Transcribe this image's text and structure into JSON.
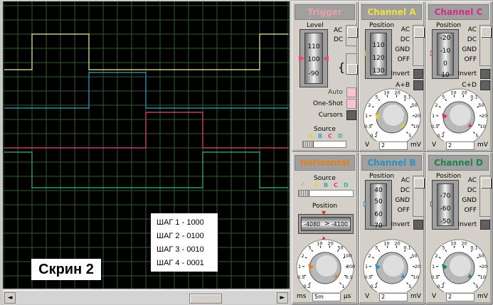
{
  "screen": {
    "steps": [
      "ШАГ 1 - 1000",
      "ШАГ 2 - 0100",
      "ШАГ 3 - 0010",
      "ШАГ 4 - 0001"
    ],
    "caption": "Скрин 2",
    "scroll_left": "◄",
    "scroll_right": "►",
    "colors": {
      "a": "#f0f0a0",
      "b": "#40a0c0",
      "c": "#e05070",
      "d": "#40b080"
    }
  },
  "trigger": {
    "title": "Trigger",
    "level": "Level",
    "ac": "AC",
    "dc": "DC",
    "drum": [
      "110",
      "100",
      "-90"
    ],
    "auto": "Auto",
    "one_shot": "One-Shot",
    "cursors": "Cursors",
    "source": "Source",
    "sources": [
      "A",
      "B",
      "C",
      "D"
    ]
  },
  "channel_a": {
    "title": "Channel A",
    "position": "Position",
    "ac": "AC",
    "dc": "DC",
    "gnd": "GND",
    "off": "OFF",
    "drum": [
      "110",
      "120",
      "130"
    ],
    "invert": "Invert",
    "sum": "A+B",
    "dial_labels": [
      "0.2",
      "0.5",
      "1",
      "2",
      "5",
      "10",
      "20",
      "0.1",
      "50",
      "20",
      "10",
      "5"
    ],
    "unit_left": "V",
    "value": "2",
    "unit_right": "mV"
  },
  "channel_c": {
    "title": "Channel C",
    "position": "Position",
    "ac": "AC",
    "dc": "DC",
    "gnd": "GND",
    "off": "OFF",
    "drum": [
      "-20",
      "-10",
      "0",
      "10"
    ],
    "invert": "Invert",
    "sum": "C+D",
    "dial_labels": [
      "0.2",
      "0.5",
      "1",
      "2",
      "5",
      "10",
      "20",
      "0.1",
      "50",
      "20",
      "10",
      "5"
    ],
    "unit_left": "V",
    "value": "2",
    "unit_right": "mV"
  },
  "horizontal": {
    "title": "Horizontal",
    "source": "Source",
    "sources": [
      "A",
      "B",
      "C",
      "D"
    ],
    "position": "Position",
    "pos_left": "-4080",
    "pos_mid": ">",
    "pos_right": "-4100",
    "dial_labels": [
      "0.2",
      "0.5",
      "1",
      "2",
      "5",
      "10",
      "20",
      "50",
      "100",
      "200",
      "0.5",
      "1"
    ],
    "unit_left": "ms",
    "value": "5m",
    "unit_right": "µs"
  },
  "channel_b": {
    "title": "Channel B",
    "position": "Position",
    "ac": "AC",
    "dc": "DC",
    "gnd": "GND",
    "off": "OFF",
    "drum": [
      "40",
      "50",
      "60",
      "70"
    ],
    "invert": "Invert",
    "dial_labels": [
      "0.2",
      "0.5",
      "1",
      "2",
      "5",
      "10",
      "20",
      "0.1",
      "50",
      "20",
      "10",
      "5"
    ],
    "unit_left": "V",
    "value": "2",
    "unit_right": "mV"
  },
  "channel_d": {
    "title": "Channel D",
    "position": "Position",
    "ac": "AC",
    "dc": "DC",
    "gnd": "GND",
    "off": "OFF",
    "drum": [
      "-70",
      "-60",
      "-50"
    ],
    "invert": "Invert",
    "dial_labels": [
      "0.2",
      "0.5",
      "1",
      "2",
      "5",
      "10",
      "20",
      "0.1",
      "50",
      "20",
      "10",
      "5"
    ],
    "unit_left": "V",
    "value": "2",
    "unit_right": "mV"
  }
}
